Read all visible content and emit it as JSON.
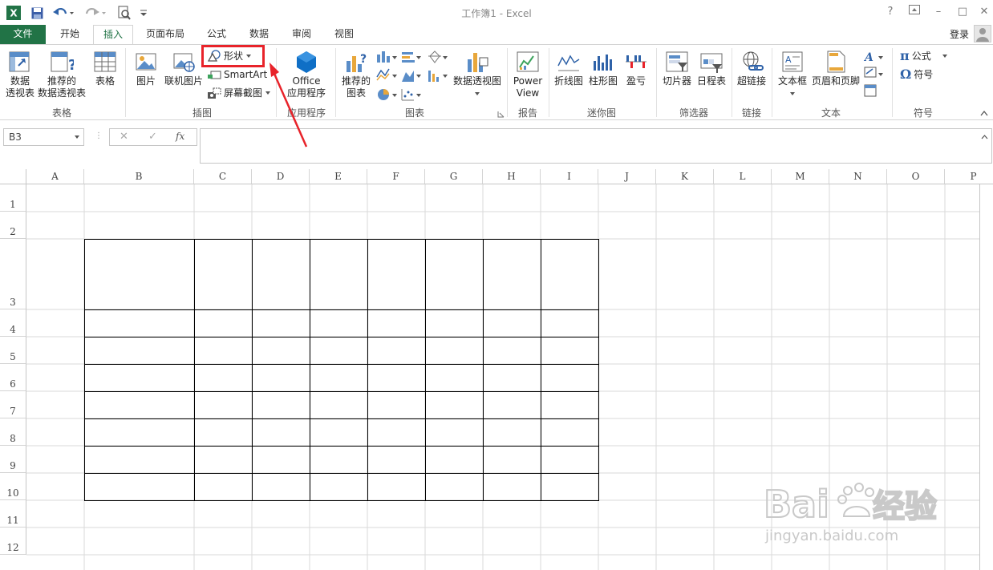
{
  "title_bar": {
    "title": "工作簿1 - Excel",
    "help": "?",
    "restore": "□",
    "minimize": "–",
    "maximize": "□",
    "close": "✕"
  },
  "tabs": [
    {
      "label": "文件"
    },
    {
      "label": "开始"
    },
    {
      "label": "插入"
    },
    {
      "label": "页面布局"
    },
    {
      "label": "公式"
    },
    {
      "label": "数据"
    },
    {
      "label": "审阅"
    },
    {
      "label": "视图"
    }
  ],
  "account": {
    "login": "登录"
  },
  "ribbon": {
    "table_group": {
      "pivot_table": "数据\n透视表",
      "recommended_pivot": "推荐的\n数据透视表",
      "table": "表格",
      "label": "表格"
    },
    "illustrations_group": {
      "pictures": "图片",
      "online_pictures": "联机图片",
      "shapes": "形状",
      "smartart": "SmartArt",
      "screenshot": "屏幕截图",
      "label": "插图"
    },
    "apps_group": {
      "office_apps": "Office\n应用程序",
      "label": "应用程序"
    },
    "charts_group": {
      "recommended_charts": "推荐的\n图表",
      "pivot_chart": "数据透视图",
      "label": "图表"
    },
    "reports_group": {
      "power_view": "Power\nView",
      "label": "报告"
    },
    "sparklines_group": {
      "line": "折线图",
      "column": "柱形图",
      "win_loss": "盈亏",
      "label": "迷你图"
    },
    "filters_group": {
      "slicer": "切片器",
      "timeline": "日程表",
      "label": "筛选器"
    },
    "links_group": {
      "hyperlink": "超链接",
      "label": "链接"
    },
    "text_group": {
      "text_box": "文本框",
      "header_footer": "页眉和页脚",
      "label": "文本"
    },
    "symbols_group": {
      "equation": "公式",
      "symbol": "符号",
      "label": "符号"
    }
  },
  "formula_bar": {
    "name_box": "B3",
    "fx": "fx",
    "cancel": "✕",
    "enter": "✓",
    "value": ""
  },
  "grid": {
    "columns": [
      "A",
      "B",
      "C",
      "D",
      "E",
      "F",
      "G",
      "H",
      "I",
      "J",
      "K",
      "L",
      "M",
      "N",
      "O",
      "P"
    ],
    "rows": [
      "1",
      "2",
      "3",
      "4",
      "5",
      "6",
      "7",
      "8",
      "9",
      "10",
      "11",
      "12"
    ],
    "bordered_range": "B3:I10"
  }
}
